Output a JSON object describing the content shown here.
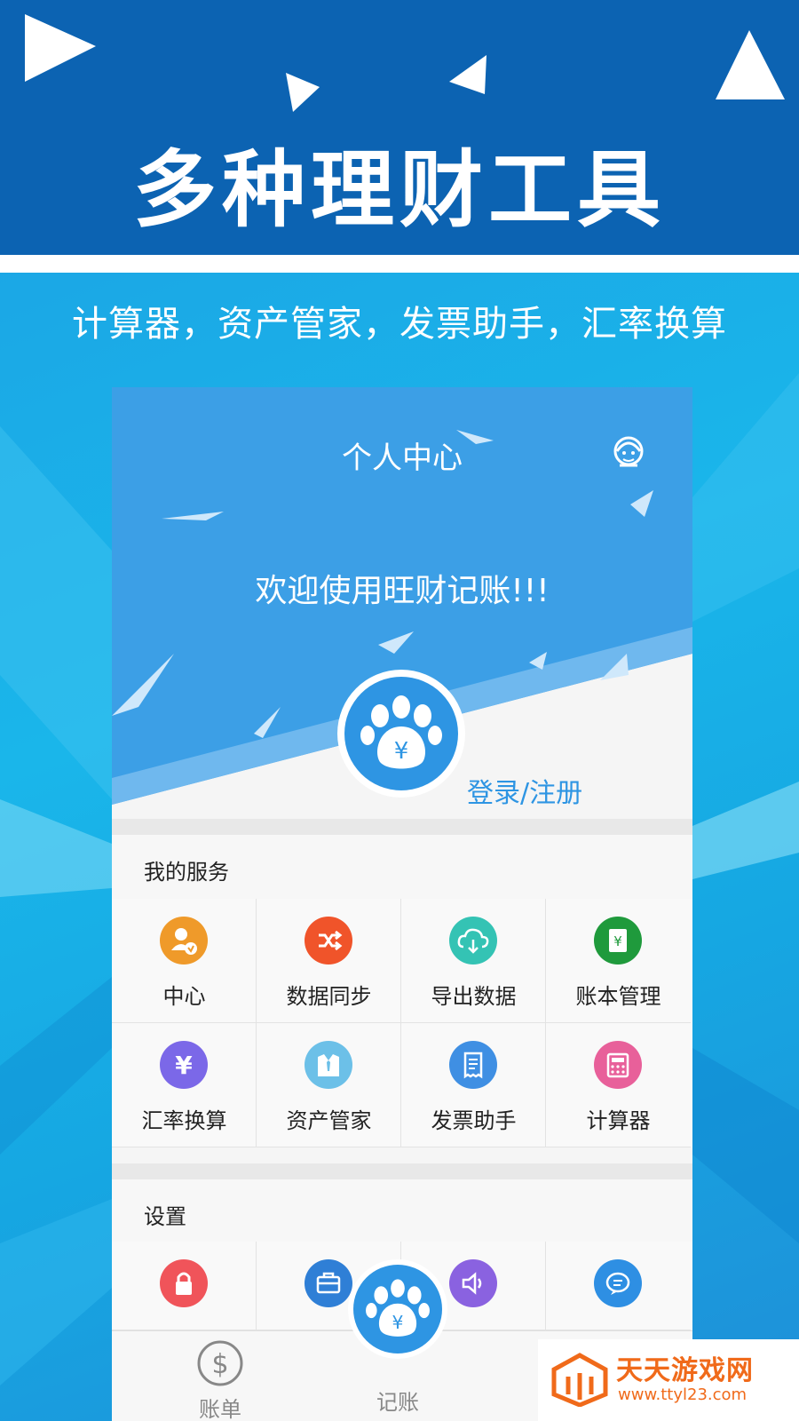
{
  "banner": {
    "headline": "多种理财工具",
    "subline": "计算器，资产管家，发票助手，汇率换算"
  },
  "app": {
    "page_title": "个人中心",
    "welcome": "欢迎使用旺财记账!!!",
    "login_label": "登录/注册",
    "services": {
      "title": "我的服务",
      "items": [
        {
          "label": "中心",
          "icon": "user-badge-icon",
          "color": "#ef9a2a"
        },
        {
          "label": "数据同步",
          "icon": "shuffle-icon",
          "color": "#f0542a"
        },
        {
          "label": "导出数据",
          "icon": "cloud-download-icon",
          "color": "#34c3b4"
        },
        {
          "label": "账本管理",
          "icon": "ledger-yen-icon",
          "color": "#1f9a3c"
        },
        {
          "label": "汇率换算",
          "icon": "yen-icon",
          "color": "#7b68e8"
        },
        {
          "label": "资产管家",
          "icon": "suit-icon",
          "color": "#6cc0e8"
        },
        {
          "label": "发票助手",
          "icon": "receipt-icon",
          "color": "#3f8fe3"
        },
        {
          "label": "计算器",
          "icon": "calculator-icon",
          "color": "#e8609a"
        }
      ]
    },
    "settings": {
      "title": "设置",
      "items": [
        {
          "icon": "lock-icon",
          "color": "#f0545a"
        },
        {
          "icon": "briefcase-icon",
          "color": "#2f7fd6"
        },
        {
          "icon": "speaker-icon",
          "color": "#8a62e0"
        },
        {
          "icon": "chat-icon",
          "color": "#2e8fe3"
        }
      ]
    },
    "tabbar": {
      "bills_label": "账单",
      "record_label": "记账"
    }
  },
  "watermark": {
    "name": "天天游戏网",
    "url": "www.ttyl23.com"
  },
  "colors": {
    "brand_blue": "#2e95e3",
    "banner_dark": "#0c63b2",
    "watermark_orange": "#f06a1a"
  }
}
